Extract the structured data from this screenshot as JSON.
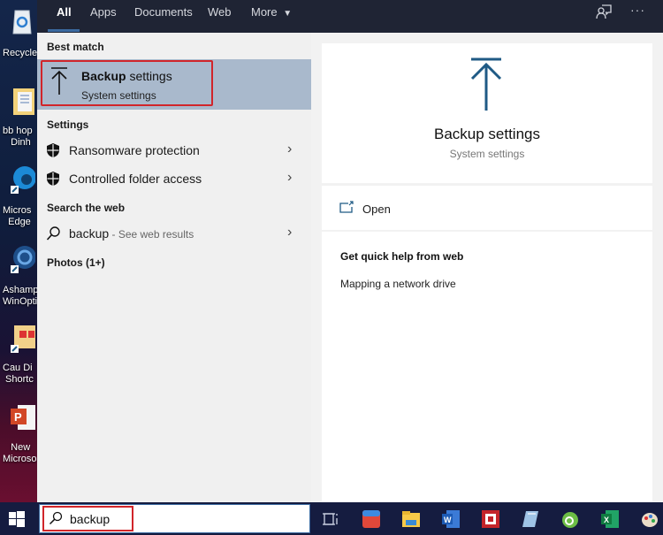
{
  "desktop": {
    "icons": [
      {
        "name": "recycle-bin",
        "label": "Recycle"
      },
      {
        "name": "bb-hop",
        "label": "bb hop\n   Dinh"
      },
      {
        "name": "microsoft-edge",
        "label": "Micros\n  Edge"
      },
      {
        "name": "ashampoo-winoptimizer",
        "label": "Ashamp\nWinOpti"
      },
      {
        "name": "cau-dinh-shortcut",
        "label": "Cau Di\n Shortc"
      },
      {
        "name": "new-microsoft-powerpoint",
        "label": "   New\nMicroso"
      }
    ]
  },
  "topbar": {
    "tabs": [
      {
        "label": "All",
        "active": true
      },
      {
        "label": "Apps",
        "active": false
      },
      {
        "label": "Documents",
        "active": false
      },
      {
        "label": "Web",
        "active": false
      },
      {
        "label": "More",
        "active": false
      }
    ],
    "more_caret": "▼",
    "feedback_icon": "feedback-icon",
    "more_options": "···"
  },
  "left": {
    "best_match_heading": "Best match",
    "best_match": {
      "title_bold": "Backup",
      "title_rest": " settings",
      "subtitle": "System settings",
      "icon": "backup-arrow-icon"
    },
    "settings_heading": "Settings",
    "settings_items": [
      {
        "label": "Ransomware protection",
        "icon": "shield-icon"
      },
      {
        "label": "Controlled folder access",
        "icon": "shield-icon"
      }
    ],
    "web_heading": "Search the web",
    "web_item": {
      "query": "backup",
      "hint": " - See web results",
      "icon": "search-icon"
    },
    "photos_heading": "Photos (1+)",
    "chevron": "›"
  },
  "right": {
    "title": "Backup settings",
    "subtitle": "System settings",
    "open_label": "Open",
    "help_heading": "Get quick help from web",
    "help_links": [
      "Mapping a network drive"
    ]
  },
  "taskbar": {
    "search_value": "backup",
    "apps": [
      {
        "name": "task-view"
      },
      {
        "name": "app-red-blue"
      },
      {
        "name": "file-explorer"
      },
      {
        "name": "word"
      },
      {
        "name": "app-red-square"
      },
      {
        "name": "notepad"
      },
      {
        "name": "app-green-circle"
      },
      {
        "name": "excel"
      },
      {
        "name": "paint"
      }
    ]
  },
  "colors": {
    "accent": "#3b6aa0",
    "highlight_border": "#d1252a",
    "selected_bg": "#a9b9cc",
    "topbar_bg": "#1f2434",
    "taskbar_bg": "#151c40",
    "icon_blue": "#1f5a85"
  }
}
